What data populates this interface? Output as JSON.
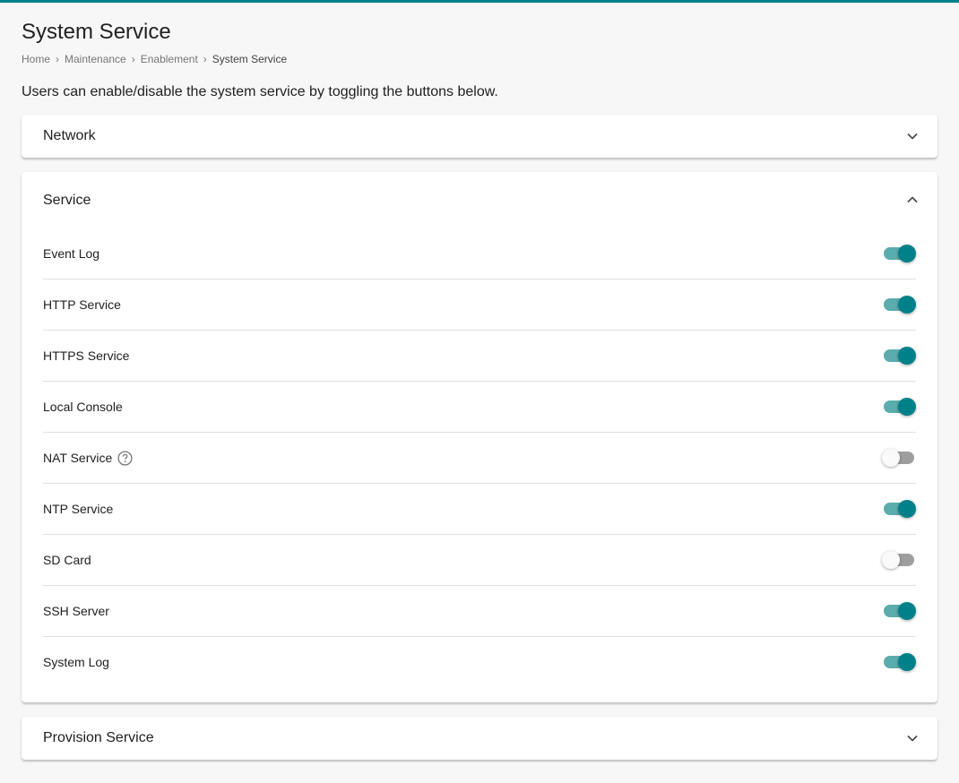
{
  "page": {
    "title": "System Service",
    "description": "Users can enable/disable the system service by toggling the buttons below."
  },
  "breadcrumb": [
    "Home",
    "Maintenance",
    "Enablement",
    "System Service"
  ],
  "colors": {
    "accent": "#00818a",
    "accent_track": "#5aacad",
    "off_track": "#9e9e9e"
  },
  "panels": {
    "network": {
      "title": "Network",
      "expanded": false,
      "icon": "chevron-down-icon"
    },
    "service": {
      "title": "Service",
      "expanded": true,
      "icon": "chevron-up-icon"
    },
    "provision": {
      "title": "Provision Service",
      "expanded": false,
      "icon": "chevron-down-icon"
    }
  },
  "services": [
    {
      "label": "Event Log",
      "enabled": true
    },
    {
      "label": "HTTP Service",
      "enabled": true
    },
    {
      "label": "HTTPS Service",
      "enabled": true
    },
    {
      "label": "Local Console",
      "enabled": true
    },
    {
      "label": "NAT Service",
      "enabled": false,
      "help_icon": "help-circle-icon"
    },
    {
      "label": "NTP Service",
      "enabled": true
    },
    {
      "label": "SD Card",
      "enabled": false
    },
    {
      "label": "SSH Server",
      "enabled": true
    },
    {
      "label": "System Log",
      "enabled": true
    }
  ]
}
